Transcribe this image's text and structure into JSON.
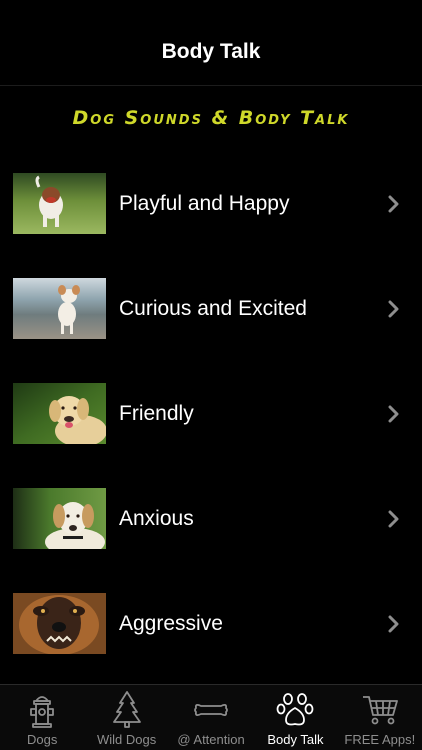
{
  "nav": {
    "title": "Body Talk"
  },
  "banner": {
    "text": "Dog Sounds & Body Talk"
  },
  "moods": [
    {
      "label": "Playful and Happy"
    },
    {
      "label": "Curious and Excited"
    },
    {
      "label": "Friendly"
    },
    {
      "label": "Anxious"
    },
    {
      "label": "Aggressive"
    }
  ],
  "tabs": [
    {
      "label": "Dogs",
      "icon": "fire-hydrant-icon"
    },
    {
      "label": "Wild Dogs",
      "icon": "tree-icon"
    },
    {
      "label": "@ Attention",
      "icon": "bone-icon"
    },
    {
      "label": "Body Talk",
      "icon": "paw-icon",
      "active": true
    },
    {
      "label": "FREE Apps!",
      "icon": "cart-icon"
    }
  ],
  "colors": {
    "background": "#000000",
    "banner": "#cfd82a",
    "tab_active": "#ffffff",
    "tab_inactive": "#8e8e8e"
  }
}
